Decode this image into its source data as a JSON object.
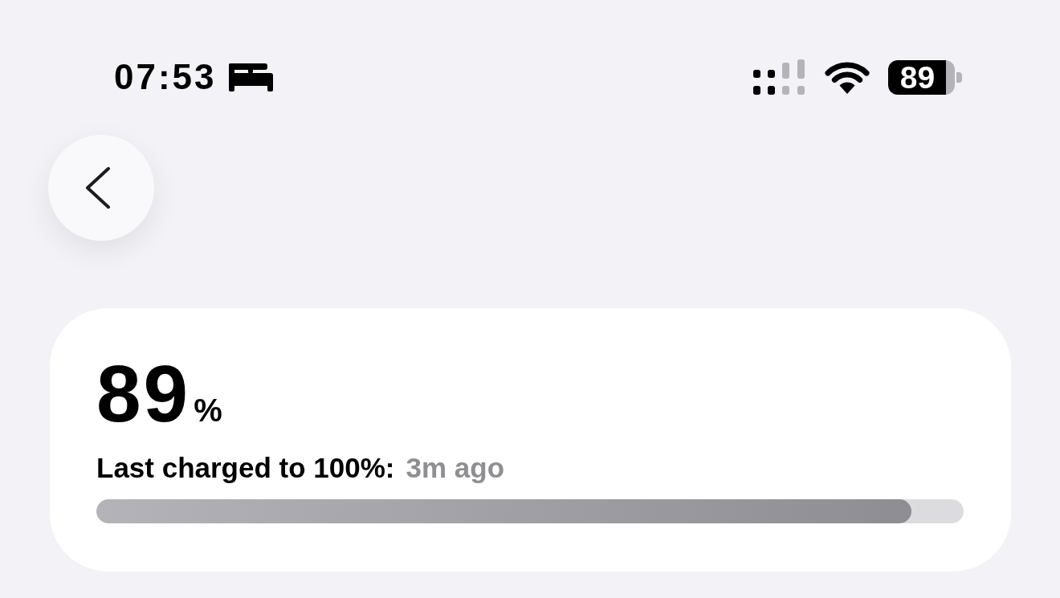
{
  "status_bar": {
    "time": "07:53",
    "battery": "89"
  },
  "battery_card": {
    "percentage": {
      "value": "89",
      "unit": "%"
    },
    "last_charged": {
      "label": "Last charged to 100%:",
      "value": "3m ago"
    },
    "charge_bar": {
      "level": 0.94
    }
  }
}
